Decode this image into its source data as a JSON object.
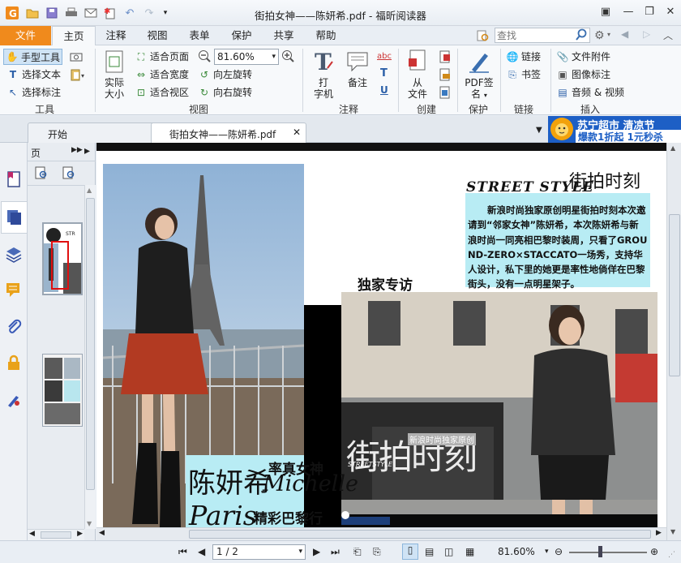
{
  "app": {
    "title": "街拍女神——陈妍希.pdf - 福昕阅读器"
  },
  "menu": {
    "file": "文件",
    "tabs": [
      "主页",
      "注释",
      "视图",
      "表单",
      "保护",
      "共享",
      "帮助"
    ],
    "search_placeholder": "查找"
  },
  "ribbon": {
    "tools": {
      "hand": "手型工具",
      "select_text": "选择文本",
      "select_annotation": "选择标注",
      "group": "工具"
    },
    "view": {
      "actual_size_1": "实际",
      "actual_size_2": "大小",
      "fit_page": "适合页面",
      "fit_width": "适合宽度",
      "fit_visible": "适合视区",
      "zoom_value": "81.60%",
      "rotate_left": "向左旋转",
      "rotate_right": "向右旋转",
      "group": "视图"
    },
    "comment": {
      "typewriter_1": "打",
      "typewriter_2": "字机",
      "note": "备注",
      "abc": "abc",
      "t": "T",
      "u": "U",
      "group": "注释"
    },
    "create": {
      "from_1": "从",
      "from_2": "文件",
      "group": "创建"
    },
    "protect": {
      "sign_1": "PDF签",
      "sign_2": "名",
      "group": "保护"
    },
    "link": {
      "link": "链接",
      "bookmark": "书签",
      "group": "链接"
    },
    "insert": {
      "attachment": "文件附件",
      "image_annotation": "图像标注",
      "audio_video": "音频 & 视频",
      "group": "插入"
    }
  },
  "doc_tabs": {
    "start": "开始",
    "file": "街拍女神——陈妍希.pdf"
  },
  "ad": {
    "line1": "苏宁超市 清凉节",
    "line2": "爆款1折起 1元秒杀"
  },
  "page_panel": {
    "title": "页"
  },
  "document": {
    "street_style": "STREET STYLE",
    "headline": "街拍时刻",
    "intro": "新浪时尚独家原创明星街拍时刻本次邀请到“邻家女神”陈妍希，本次陈妍希与新浪时尚一同亮相巴黎时装周，只看了GROUND-ZERO×STACCATO一场秀，支持华人设计，私下里的她更是率性地倘佯在巴黎街头，没有一点明星架子。",
    "exclusive": "独家专访",
    "name": "陈妍希",
    "tagline": "率真女神",
    "michelle": "Michelle",
    "paris": "Paris",
    "paris_cn": "精彩巴黎行",
    "overlay_big": "街拍时刻",
    "overlay_small": "新浪时尚独家原创",
    "overlay_street": "STREETSTYLE"
  },
  "status": {
    "page_value": "1 / 2",
    "zoom": "81.60%"
  },
  "colors": {
    "accent": "#f08a1c",
    "ad_blue": "#1d5fc5",
    "caption_bg": "#b8ecf4"
  }
}
